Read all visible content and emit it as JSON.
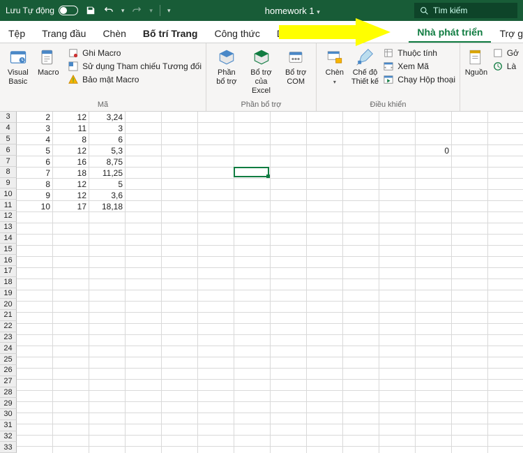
{
  "title": {
    "autosave": "Lưu Tự động",
    "filename": "homework 1"
  },
  "search": {
    "placeholder": "Tìm kiếm"
  },
  "tabs": {
    "file": "Tệp",
    "home": "Trang đầu",
    "insert": "Chèn",
    "layout": "Bố trí Trang",
    "formulas": "Công thức",
    "data": "Dữ",
    "developer": "Nhà phát triển",
    "help": "Trợ giúp"
  },
  "ribbon": {
    "code": {
      "visual_basic": "Visual\nBasic",
      "macros": "Macro",
      "record": "Ghi Macro",
      "relative": "Sử dụng Tham chiếu Tương đối",
      "security": "Bảo mật Macro",
      "label": "Mã"
    },
    "addins": {
      "addins": "Phần\nbổ trợ",
      "excel_addins": "Bổ trợ\ncủa Excel",
      "com_addins": "Bổ trợ\nCOM",
      "label": "Phần bổ trợ"
    },
    "controls": {
      "insert": "Chèn",
      "design": "Chế độ\nThiết kế",
      "properties": "Thuộc tính",
      "view_code": "Xem Mã",
      "run_dialog": "Chạy Hộp thoại",
      "label": "Điều khiển"
    },
    "xml": {
      "source": "Nguồn",
      "go": "Gở",
      "la": "Là"
    }
  },
  "grid": {
    "row_start": 3,
    "row_count": 31,
    "cols": 14,
    "rows": [
      [
        "2",
        "12",
        "3,24",
        "",
        "",
        "",
        "",
        "",
        "",
        "",
        "",
        "",
        "",
        ""
      ],
      [
        "3",
        "11",
        "3",
        "",
        "",
        "",
        "",
        "",
        "",
        "",
        "",
        "",
        "",
        ""
      ],
      [
        "4",
        "8",
        "6",
        "",
        "",
        "",
        "",
        "",
        "",
        "",
        "",
        "",
        "",
        ""
      ],
      [
        "5",
        "12",
        "5,3",
        "",
        "",
        "",
        "",
        "",
        "",
        "",
        "",
        "0",
        "",
        ""
      ],
      [
        "6",
        "16",
        "8,75",
        "",
        "",
        "",
        "",
        "",
        "",
        "",
        "",
        "",
        "",
        ""
      ],
      [
        "7",
        "18",
        "11,25",
        "",
        "",
        "",
        "",
        "",
        "",
        "",
        "",
        "",
        "",
        ""
      ],
      [
        "8",
        "12",
        "5",
        "",
        "",
        "",
        "",
        "",
        "",
        "",
        "",
        "",
        "",
        ""
      ],
      [
        "9",
        "12",
        "3,6",
        "",
        "",
        "",
        "",
        "",
        "",
        "",
        "",
        "",
        "",
        ""
      ],
      [
        "10",
        "17",
        "18,18",
        "",
        "",
        "",
        "",
        "",
        "",
        "",
        "",
        "",
        "",
        ""
      ]
    ],
    "selection": {
      "row": 8,
      "col": 6
    }
  }
}
